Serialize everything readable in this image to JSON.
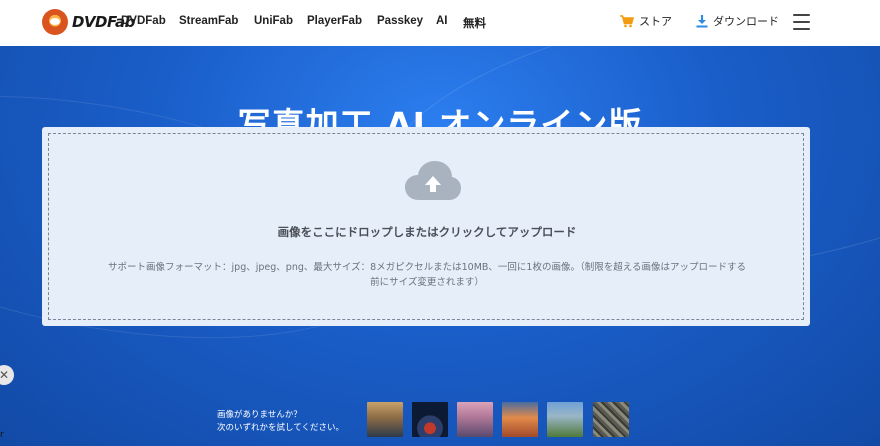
{
  "header": {
    "logo_text": "DVDFab",
    "nav": [
      "DVDFab",
      "StreamFab",
      "UniFab",
      "PlayerFab",
      "Passkey",
      "AI",
      "無料"
    ],
    "store_label": "ストア",
    "download_label": "ダウンロード",
    "colors": {
      "store_icon": "#f39c12",
      "download_icon": "#2d8be6"
    }
  },
  "hero": {
    "title": "写真加工 AI オンライン版"
  },
  "upload": {
    "main_text": "画像をここにドロップしまたはクリックしてアップロード",
    "note_line1": "サポート画像フォーマット：jpg、jpeg、png、最大サイズ：8メガピクセルまたは10MB、一回に1枚の画像。（制限を超える画像はアップロードする",
    "note_line2": "前にサイズ変更されます）"
  },
  "samples": {
    "line1": "画像がありませんか？",
    "line2": "次のいずれかを試してください。"
  },
  "side": {
    "close_glyph": "✕",
    "corner_glyph": "r"
  }
}
